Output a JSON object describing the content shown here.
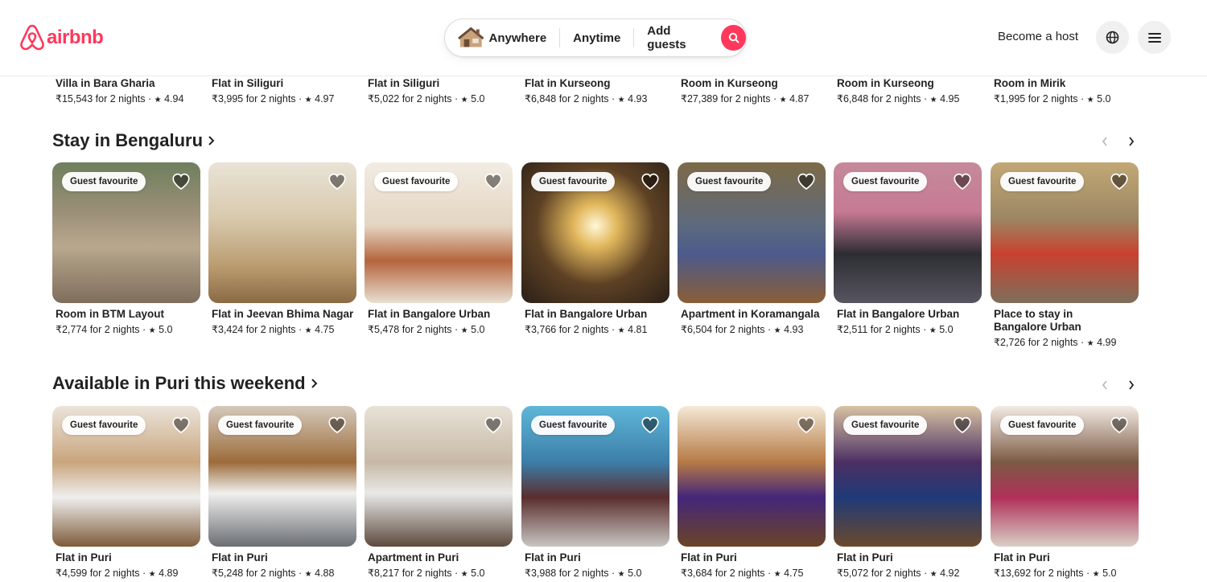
{
  "header": {
    "logo_text": "airbnb",
    "search": {
      "where": "Anywhere",
      "when": "Anytime",
      "who": "Add guests"
    },
    "become_host": "Become a host",
    "globe_icon": "globe-icon",
    "menu_icon": "menu-icon"
  },
  "brand_color": "#ff385c",
  "top_row": [
    {
      "title": "Villa in Bara Gharia",
      "price": "₹15,543 for 2 nights",
      "rating": "4.94"
    },
    {
      "title": "Flat in Siliguri",
      "price": "₹3,995 for 2 nights",
      "rating": "4.97"
    },
    {
      "title": "Flat in Siliguri",
      "price": "₹5,022 for 2 nights",
      "rating": "5.0"
    },
    {
      "title": "Flat in Kurseong",
      "price": "₹6,848 for 2 nights",
      "rating": "4.93"
    },
    {
      "title": "Room in Kurseong",
      "price": "₹27,389 for 2 nights",
      "rating": "4.87"
    },
    {
      "title": "Room in Kurseong",
      "price": "₹6,848 for 2 nights",
      "rating": "4.95"
    },
    {
      "title": "Room in Mirik",
      "price": "₹1,995 for 2 nights",
      "rating": "5.0"
    }
  ],
  "sections": [
    {
      "title": "Stay in Bengaluru",
      "listings": [
        {
          "title": "Room in BTM Layout",
          "price": "₹2,774 for 2 nights",
          "rating": "5.0",
          "badge": "Guest favourite"
        },
        {
          "title": "Flat in Jeevan Bhima Nagar",
          "price": "₹3,424 for 2 nights",
          "rating": "4.75",
          "badge": ""
        },
        {
          "title": "Flat in Bangalore Urban",
          "price": "₹5,478 for 2 nights",
          "rating": "5.0",
          "badge": "Guest favourite"
        },
        {
          "title": "Flat in Bangalore Urban",
          "price": "₹3,766 for 2 nights",
          "rating": "4.81",
          "badge": "Guest favourite"
        },
        {
          "title": "Apartment in Koramangala",
          "price": "₹6,504 for 2 nights",
          "rating": "4.93",
          "badge": "Guest favourite"
        },
        {
          "title": "Flat in Bangalore Urban",
          "price": "₹2,511 for 2 nights",
          "rating": "5.0",
          "badge": "Guest favourite"
        },
        {
          "title": "Place to stay in Bangalore Urban",
          "price": "₹2,726 for 2 nights",
          "rating": "4.99",
          "badge": "Guest favourite"
        }
      ]
    },
    {
      "title": "Available in Puri this weekend",
      "listings": [
        {
          "title": "Flat in Puri",
          "price": "₹4,599 for 2 nights",
          "rating": "4.89",
          "badge": "Guest favourite"
        },
        {
          "title": "Flat in Puri",
          "price": "₹5,248 for 2 nights",
          "rating": "4.88",
          "badge": "Guest favourite"
        },
        {
          "title": "Apartment in Puri",
          "price": "₹8,217 for 2 nights",
          "rating": "5.0",
          "badge": ""
        },
        {
          "title": "Flat in Puri",
          "price": "₹3,988 for 2 nights",
          "rating": "5.0",
          "badge": "Guest favourite"
        },
        {
          "title": "Flat in Puri",
          "price": "₹3,684 for 2 nights",
          "rating": "4.75",
          "badge": ""
        },
        {
          "title": "Flat in Puri",
          "price": "₹5,072 for 2 nights",
          "rating": "4.92",
          "badge": "Guest favourite"
        },
        {
          "title": "Flat in Puri",
          "price": "₹13,692 for 2 nights",
          "rating": "5.0",
          "badge": "Guest favourite"
        }
      ]
    }
  ],
  "separator": " · ",
  "star": "★"
}
